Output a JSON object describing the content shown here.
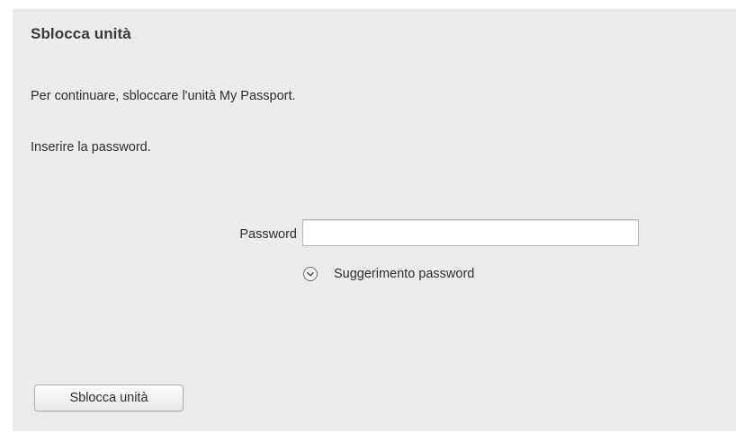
{
  "dialog": {
    "title": "Sblocca unità",
    "message_continue": "Per continuare, sbloccare l'unità My Passport.",
    "message_enter": "Inserire la password."
  },
  "password": {
    "label": "Password",
    "value": "",
    "placeholder": ""
  },
  "hint": {
    "label": "Suggerimento password",
    "icon": "chevron-down-circle-icon"
  },
  "actions": {
    "unlock_label": "Sblocca unità"
  },
  "colors": {
    "panel_background": "#ececec",
    "text": "#2f2f2f",
    "title_text": "#3a3a3a"
  }
}
